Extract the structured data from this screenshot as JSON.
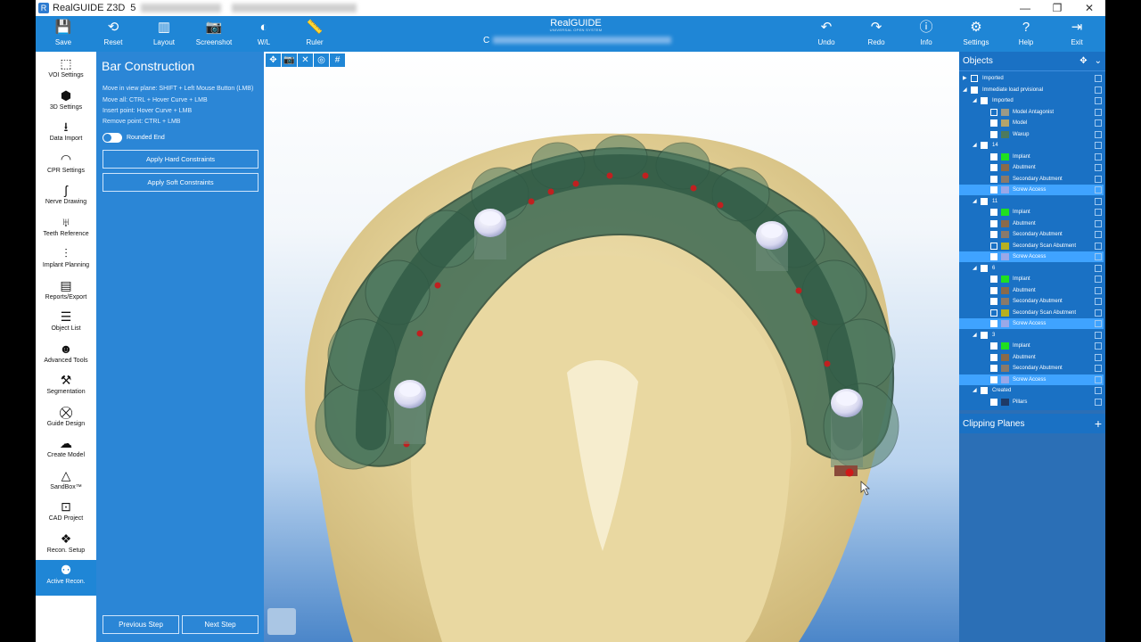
{
  "window": {
    "title": "RealGUIDE Z3D",
    "version_prefix": "5",
    "controls": [
      "—",
      "❐",
      "✕"
    ]
  },
  "toolbar": {
    "left": [
      {
        "label": "Save",
        "icon": "save-icon",
        "glyph": "💾"
      },
      {
        "label": "Reset",
        "icon": "reset-icon",
        "glyph": "⟲"
      },
      {
        "label": "Layout",
        "icon": "layout-icon",
        "glyph": "▥"
      },
      {
        "label": "Screenshot",
        "icon": "camera-icon",
        "glyph": "📷"
      },
      {
        "label": "W/L",
        "icon": "contrast-icon",
        "glyph": "◐"
      },
      {
        "label": "Ruler",
        "icon": "ruler-icon",
        "glyph": "📏"
      }
    ],
    "right": [
      {
        "label": "Undo",
        "icon": "undo-icon",
        "glyph": "↶"
      },
      {
        "label": "Redo",
        "icon": "redo-icon",
        "glyph": "↷"
      },
      {
        "label": "Info",
        "icon": "info-icon",
        "glyph": "ⓘ"
      },
      {
        "label": "Settings",
        "icon": "gear-icon",
        "glyph": "⚙"
      },
      {
        "label": "Help",
        "icon": "help-icon",
        "glyph": "?"
      },
      {
        "label": "Exit",
        "icon": "exit-icon",
        "glyph": "⇥"
      }
    ],
    "logo": "RealGUIDE",
    "logo_sub": "UNIVERSAL OPEN SYSTEM",
    "patient_prefix": "C"
  },
  "sidebar": {
    "items": [
      {
        "label": "VOI Settings",
        "icon": "voi-cube-icon",
        "glyph": "⬚"
      },
      {
        "label": "3D Settings",
        "icon": "3d-cube-icon",
        "glyph": "⬢"
      },
      {
        "label": "Data Import",
        "icon": "import-icon",
        "glyph": "⭳"
      },
      {
        "label": "CPR Settings",
        "icon": "cpr-curve-icon",
        "glyph": "◠"
      },
      {
        "label": "Nerve Drawing",
        "icon": "nerve-icon",
        "glyph": "ʃ"
      },
      {
        "label": "Teeth Reference",
        "icon": "tooth-icon",
        "glyph": "♅"
      },
      {
        "label": "Implant Planning",
        "icon": "implant-icon",
        "glyph": "⫶"
      },
      {
        "label": "Reports/Export",
        "icon": "report-icon",
        "glyph": "▤"
      },
      {
        "label": "Object List",
        "icon": "list-icon",
        "glyph": "☰"
      },
      {
        "label": "Advanced Tools",
        "icon": "head-icon",
        "glyph": "☻"
      },
      {
        "label": "Segmentation",
        "icon": "wand-icon",
        "glyph": "⚒"
      },
      {
        "label": "Guide Design",
        "icon": "guide-icon",
        "glyph": "⛒"
      },
      {
        "label": "Create Model",
        "icon": "model-icon",
        "glyph": "☁"
      },
      {
        "label": "SandBox™",
        "icon": "sandbox-icon",
        "glyph": "△"
      },
      {
        "label": "CAD Project",
        "icon": "cad-icon",
        "glyph": "⊡"
      },
      {
        "label": "Recon. Setup",
        "icon": "recon-setup-icon",
        "glyph": "❖"
      },
      {
        "label": "Active Recon.",
        "icon": "active-recon-icon",
        "glyph": "⚉"
      }
    ]
  },
  "panel": {
    "title": "Bar Construction",
    "hints": [
      "Move in view plane: SHIFT + Left Mouse Button (LMB)",
      "Move all: CTRL + Hover Curve + LMB",
      "Insert point: Hover Curve + LMB",
      "Remove point: CTRL + LMB"
    ],
    "rounded_end_label": "Rounded End",
    "rounded_end_on": false,
    "apply_hard": "Apply Hard Constraints",
    "apply_soft": "Apply Soft Constraints",
    "previous_step": "Previous Step",
    "next_step": "Next Step"
  },
  "viewport": {
    "tool_glyphs": [
      "✥",
      "📷",
      "✕",
      "◎",
      "#"
    ]
  },
  "objects": {
    "title": "Objects",
    "tree": [
      {
        "label": "Imported",
        "level": 0,
        "arrow": "▶",
        "checked": false,
        "swatch": null
      },
      {
        "label": "Immediate load prvisional",
        "level": 0,
        "arrow": "◢",
        "checked": true,
        "swatch": null
      },
      {
        "label": "Imported",
        "level": 1,
        "arrow": "◢",
        "checked": true,
        "swatch": null
      },
      {
        "label": "Model Antagonist",
        "level": 2,
        "arrow": "",
        "checked": false,
        "swatch": "#9c9a86"
      },
      {
        "label": "Model",
        "level": 2,
        "arrow": "",
        "checked": true,
        "swatch": "#b3a46b"
      },
      {
        "label": "Waxup",
        "level": 2,
        "arrow": "",
        "checked": true,
        "swatch": "#4d7a5d"
      },
      {
        "label": "14",
        "level": 1,
        "arrow": "◢",
        "checked": true,
        "swatch": null
      },
      {
        "label": "Implant",
        "level": 2,
        "arrow": "",
        "checked": true,
        "swatch": "#20e020"
      },
      {
        "label": "Abutment",
        "level": 2,
        "arrow": "",
        "checked": true,
        "swatch": "#8a6a4a"
      },
      {
        "label": "Secondary Abutment",
        "level": 2,
        "arrow": "",
        "checked": true,
        "swatch": "#8a7a6a"
      },
      {
        "label": "Screw Access",
        "level": 2,
        "arrow": "",
        "checked": true,
        "swatch": "#9aa8e8",
        "hl": true
      },
      {
        "label": "11",
        "level": 1,
        "arrow": "◢",
        "checked": true,
        "swatch": null
      },
      {
        "label": "Implant",
        "level": 2,
        "arrow": "",
        "checked": true,
        "swatch": "#20e020"
      },
      {
        "label": "Abutment",
        "level": 2,
        "arrow": "",
        "checked": true,
        "swatch": "#8a6a4a"
      },
      {
        "label": "Secondary Abutment",
        "level": 2,
        "arrow": "",
        "checked": true,
        "swatch": "#8a7a6a"
      },
      {
        "label": "Secondary Scan Abutment",
        "level": 2,
        "arrow": "",
        "checked": false,
        "swatch": "#b8b020"
      },
      {
        "label": "Screw Access",
        "level": 2,
        "arrow": "",
        "checked": true,
        "swatch": "#9aa8e8",
        "hl": true
      },
      {
        "label": "6",
        "level": 1,
        "arrow": "◢",
        "checked": true,
        "swatch": null
      },
      {
        "label": "Implant",
        "level": 2,
        "arrow": "",
        "checked": true,
        "swatch": "#20e020"
      },
      {
        "label": "Abutment",
        "level": 2,
        "arrow": "",
        "checked": true,
        "swatch": "#8a6a4a"
      },
      {
        "label": "Secondary Abutment",
        "level": 2,
        "arrow": "",
        "checked": true,
        "swatch": "#8a7a6a"
      },
      {
        "label": "Secondary Scan Abutment",
        "level": 2,
        "arrow": "",
        "checked": false,
        "swatch": "#b8b020"
      },
      {
        "label": "Screw Access",
        "level": 2,
        "arrow": "",
        "checked": true,
        "swatch": "#9aa8e8",
        "hl": true
      },
      {
        "label": "3",
        "level": 1,
        "arrow": "◢",
        "checked": true,
        "swatch": null
      },
      {
        "label": "Implant",
        "level": 2,
        "arrow": "",
        "checked": true,
        "swatch": "#20e020"
      },
      {
        "label": "Abutment",
        "level": 2,
        "arrow": "",
        "checked": true,
        "swatch": "#8a6a4a"
      },
      {
        "label": "Secondary Abutment",
        "level": 2,
        "arrow": "",
        "checked": true,
        "swatch": "#8a7a6a"
      },
      {
        "label": "Screw Access",
        "level": 2,
        "arrow": "",
        "checked": true,
        "swatch": "#9aa8e8",
        "hl": true
      },
      {
        "label": "Created",
        "level": 1,
        "arrow": "◢",
        "checked": true,
        "swatch": null
      },
      {
        "label": "Pillars",
        "level": 2,
        "arrow": "",
        "checked": true,
        "swatch": "#1e3a66"
      }
    ]
  },
  "clipping": {
    "title": "Clipping Planes",
    "add_glyph": "+"
  },
  "colors": {
    "accent": "#1f86d6",
    "panel": "#2b86d6",
    "model_stone": "#e3d29c",
    "waxup_green": "#3d6a54"
  }
}
